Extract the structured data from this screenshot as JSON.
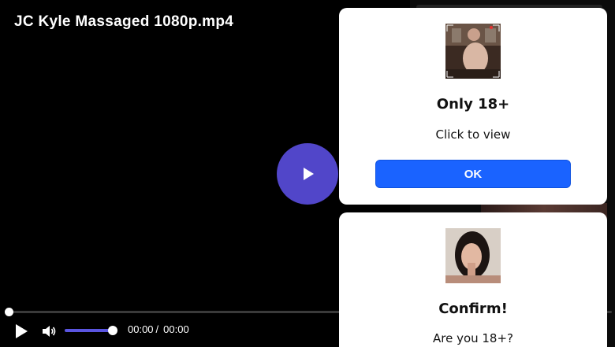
{
  "player": {
    "title": "JC Kyle Massaged 1080p.mp4",
    "current_time": "00:00",
    "separator": "/",
    "duration": "00:00",
    "progress": 0,
    "volume": 0.92,
    "accent_color": "#5146c9"
  },
  "popups": [
    {
      "heading": "Only 18+",
      "text": "Click to view",
      "button_label": "OK",
      "button_color": "#1a63ff"
    },
    {
      "heading": "Confirm!",
      "text": "Are you 18+?"
    }
  ],
  "icons": {
    "big_play": "play-icon",
    "control_play": "play-icon",
    "volume": "speaker-icon"
  }
}
